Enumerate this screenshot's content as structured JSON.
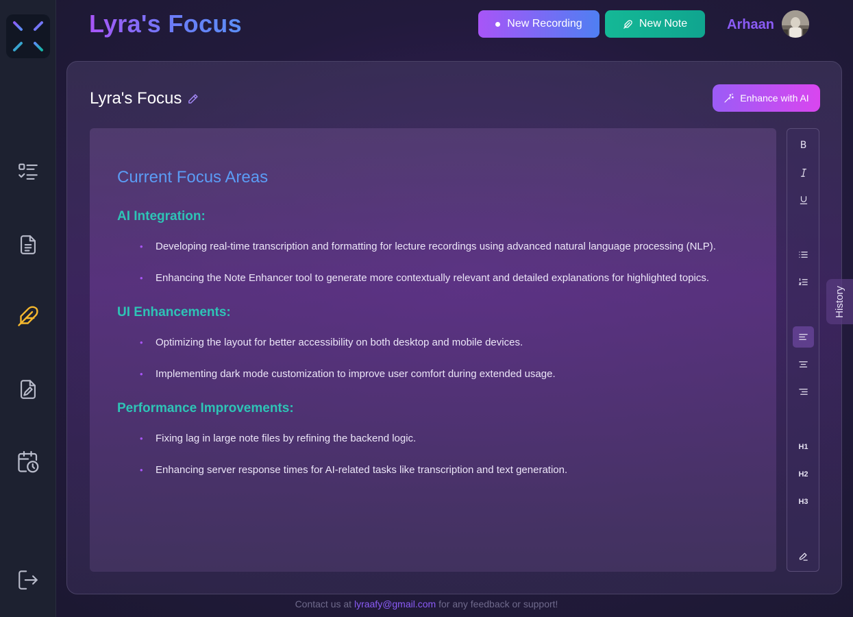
{
  "app": {
    "title": "Lyra's Focus"
  },
  "header": {
    "new_recording_label": "New Recording",
    "new_note_label": "New Note",
    "username": "Arhaan"
  },
  "sidebar": {
    "items": [
      {
        "name": "tasks",
        "icon": "checklist-icon"
      },
      {
        "name": "documents",
        "icon": "document-icon"
      },
      {
        "name": "notes",
        "icon": "feather-icon",
        "active": true
      },
      {
        "name": "edit-files",
        "icon": "file-edit-icon"
      },
      {
        "name": "calendar",
        "icon": "calendar-clock-icon"
      },
      {
        "name": "logout",
        "icon": "logout-icon"
      }
    ]
  },
  "note": {
    "title": "Lyra's Focus",
    "enhance_label": "Enhance with AI",
    "heading": "Current Focus Areas",
    "sections": [
      {
        "heading": "AI Integration:",
        "items": [
          "Developing real-time transcription and formatting for lecture recordings using advanced natural language processing (NLP).",
          "Enhancing the Note Enhancer tool to generate more contextually relevant and detailed explanations for highlighted topics."
        ]
      },
      {
        "heading": "UI Enhancements:",
        "items": [
          "Optimizing the layout for better accessibility on both desktop and mobile devices.",
          "Implementing dark mode customization to improve user comfort during extended usage."
        ]
      },
      {
        "heading": "Performance Improvements:",
        "items": [
          "Fixing lag in large note files by refining the backend logic.",
          "Enhancing server response times for AI-related tasks like transcription and text generation."
        ]
      }
    ]
  },
  "toolbar": {
    "bold": "B",
    "italic": "I",
    "underline": "U",
    "h1": "H1",
    "h2": "H2",
    "h3": "H3"
  },
  "history_label": "History",
  "footer": {
    "prefix": "Contact us at",
    "email": "lyraafy@gmail.com",
    "suffix": "for any feedback or support!"
  },
  "colors": {
    "accent_purple": "#a855f7",
    "accent_teal": "#14b896",
    "heading_blue": "#5b9cf5",
    "section_teal": "#2ec4b6",
    "active_nav": "#f5b82e"
  }
}
